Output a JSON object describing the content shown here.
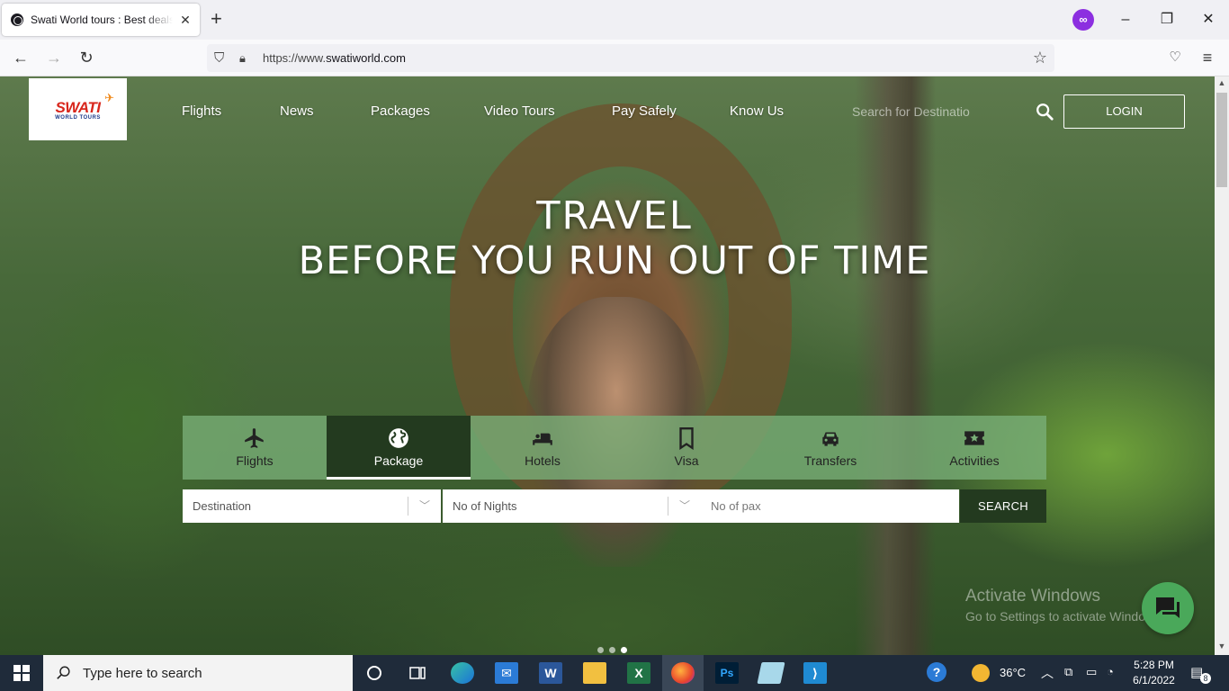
{
  "browser": {
    "tab_title": "Swati World tours : Best deals in",
    "new_tab": "+",
    "url_prefix": "https://www.",
    "url_domain": "swatiworld.com"
  },
  "site": {
    "logo_main": "SWATI",
    "logo_sub": "WORLD TOURS",
    "nav": [
      "Flights",
      "News",
      "Packages",
      "Video Tours",
      "Pay Safely",
      "Know Us"
    ],
    "search_placeholder": "Search for Destinatio",
    "login_label": "LOGIN",
    "headline_line1": "TRAVEL",
    "headline_line2": "BEFORE YOU RUN OUT OF TIME",
    "service_tabs": [
      {
        "label": "Flights",
        "icon": "airplane-icon"
      },
      {
        "label": "Package",
        "icon": "globe-icon",
        "active": true
      },
      {
        "label": "Hotels",
        "icon": "bed-icon"
      },
      {
        "label": "Visa",
        "icon": "bookmark-icon"
      },
      {
        "label": "Transfers",
        "icon": "car-icon"
      },
      {
        "label": "Activities",
        "icon": "ticket-star-icon"
      }
    ],
    "form": {
      "destination_placeholder": "Destination",
      "nights_placeholder": "No of Nights",
      "pax_placeholder": "No of pax",
      "search_label": "SEARCH"
    },
    "carousel_slide_count": 3
  },
  "overlay": {
    "watermark_line1": "Activate Windows",
    "watermark_line2": "Go to Settings to activate Windows."
  },
  "taskbar": {
    "search_placeholder": "Type here to search",
    "temperature": "36°C",
    "time": "5:28 PM",
    "date": "6/1/2022",
    "notification_count": "8"
  },
  "colors": {
    "tab_active": "#233a1f",
    "tab_strip": "#7ab078",
    "chat_button": "#4aa85a",
    "logo_red": "#d8261c"
  }
}
